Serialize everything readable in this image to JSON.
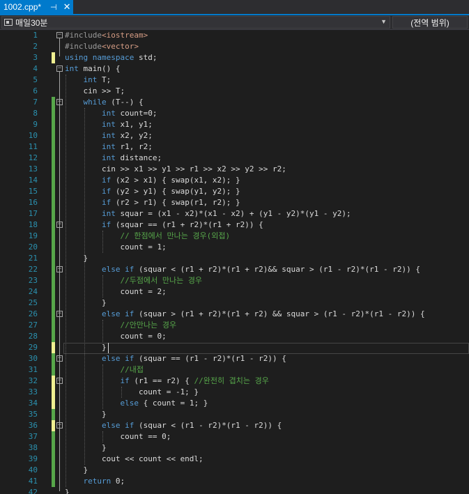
{
  "tab": {
    "filename": "1002.cpp*",
    "pin_glyph": "⊣",
    "close_glyph": "✕"
  },
  "nav": {
    "project": "매일30분",
    "scope": "(전역 범위)"
  },
  "lines": [
    [
      [
        "p",
        "#include"
      ],
      [
        "s",
        "<iostream>"
      ]
    ],
    [
      [
        "p",
        "#include"
      ],
      [
        "s",
        "<vector>"
      ]
    ],
    [
      [
        "k",
        "using"
      ],
      [
        "t",
        " "
      ],
      [
        "k",
        "namespace"
      ],
      [
        "t",
        " std;"
      ]
    ],
    [
      [
        "k",
        "int"
      ],
      [
        "t",
        " main() {"
      ]
    ],
    [
      [
        "t",
        "    "
      ],
      [
        "k",
        "int"
      ],
      [
        "t",
        " T;"
      ]
    ],
    [
      [
        "t",
        "    cin >> T;"
      ]
    ],
    [
      [
        "t",
        "    "
      ],
      [
        "k",
        "while"
      ],
      [
        "t",
        " (T--) {"
      ]
    ],
    [
      [
        "t",
        "        "
      ],
      [
        "k",
        "int"
      ],
      [
        "t",
        " count=0;"
      ]
    ],
    [
      [
        "t",
        "        "
      ],
      [
        "k",
        "int"
      ],
      [
        "t",
        " x1, y1;"
      ]
    ],
    [
      [
        "t",
        "        "
      ],
      [
        "k",
        "int"
      ],
      [
        "t",
        " x2, y2;"
      ]
    ],
    [
      [
        "t",
        "        "
      ],
      [
        "k",
        "int"
      ],
      [
        "t",
        " r1, r2;"
      ]
    ],
    [
      [
        "t",
        "        "
      ],
      [
        "k",
        "int"
      ],
      [
        "t",
        " distance;"
      ]
    ],
    [
      [
        "t",
        "        cin >> x1 >> y1 >> r1 >> x2 >> y2 >> r2;"
      ]
    ],
    [
      [
        "t",
        "        "
      ],
      [
        "k",
        "if"
      ],
      [
        "t",
        " (x2 > x1) { swap(x1, x2); }"
      ]
    ],
    [
      [
        "t",
        "        "
      ],
      [
        "k",
        "if"
      ],
      [
        "t",
        " (y2 > y1) { swap(y1, y2); }"
      ]
    ],
    [
      [
        "t",
        "        "
      ],
      [
        "k",
        "if"
      ],
      [
        "t",
        " (r2 > r1) { swap(r1, r2); }"
      ]
    ],
    [
      [
        "t",
        "        "
      ],
      [
        "k",
        "int"
      ],
      [
        "t",
        " squar = (x1 - x2)*(x1 - x2) + (y1 - y2)*(y1 - y2);"
      ]
    ],
    [
      [
        "t",
        "        "
      ],
      [
        "k",
        "if"
      ],
      [
        "t",
        " (squar == (r1 + r2)*(r1 + r2)) {"
      ]
    ],
    [
      [
        "t",
        "            "
      ],
      [
        "c",
        "// 한점에서 만나는 경우(외접)"
      ]
    ],
    [
      [
        "t",
        "            count = 1;"
      ]
    ],
    [
      [
        "t",
        "    }"
      ]
    ],
    [
      [
        "t",
        "        "
      ],
      [
        "k",
        "else"
      ],
      [
        "t",
        " "
      ],
      [
        "k",
        "if"
      ],
      [
        "t",
        " (squar < (r1 + r2)*(r1 + r2)&& squar > (r1 - r2)*(r1 - r2)) {"
      ]
    ],
    [
      [
        "t",
        "            "
      ],
      [
        "c",
        "//두점에서 만나는 경우"
      ]
    ],
    [
      [
        "t",
        "            count = 2;"
      ]
    ],
    [
      [
        "t",
        "        }"
      ]
    ],
    [
      [
        "t",
        "        "
      ],
      [
        "k",
        "else"
      ],
      [
        "t",
        " "
      ],
      [
        "k",
        "if"
      ],
      [
        "t",
        " (squar > (r1 + r2)*(r1 + r2) && squar > (r1 - r2)*(r1 - r2)) {"
      ]
    ],
    [
      [
        "t",
        "            "
      ],
      [
        "c",
        "//안만나는 경우"
      ]
    ],
    [
      [
        "t",
        "            count = 0;"
      ]
    ],
    [
      [
        "t",
        "        }"
      ]
    ],
    [
      [
        "t",
        "        "
      ],
      [
        "k",
        "else"
      ],
      [
        "t",
        " "
      ],
      [
        "k",
        "if"
      ],
      [
        "t",
        " (squar == (r1 - r2)*(r1 - r2)) {"
      ]
    ],
    [
      [
        "t",
        "            "
      ],
      [
        "c",
        "//내접"
      ]
    ],
    [
      [
        "t",
        "            "
      ],
      [
        "k",
        "if"
      ],
      [
        "t",
        " (r1 == r2) { "
      ],
      [
        "c",
        "//완전히 겹치는 경우"
      ]
    ],
    [
      [
        "t",
        "                count = -1; }"
      ]
    ],
    [
      [
        "t",
        "            "
      ],
      [
        "k",
        "else"
      ],
      [
        "t",
        " { count = 1; }"
      ]
    ],
    [
      [
        "t",
        "        }"
      ]
    ],
    [
      [
        "t",
        "        "
      ],
      [
        "k",
        "else"
      ],
      [
        "t",
        " "
      ],
      [
        "k",
        "if"
      ],
      [
        "t",
        " (squar < (r1 - r2)*(r1 - r2)) {"
      ]
    ],
    [
      [
        "t",
        "            count == 0;"
      ]
    ],
    [
      [
        "t",
        "        }"
      ]
    ],
    [
      [
        "t",
        "        cout << count << endl;"
      ]
    ],
    [
      [
        "t",
        "    }"
      ]
    ],
    [
      [
        "t",
        "    "
      ],
      [
        "k",
        "return"
      ],
      [
        "t",
        " 0;"
      ]
    ],
    [
      [
        "t",
        "}"
      ]
    ]
  ]
}
